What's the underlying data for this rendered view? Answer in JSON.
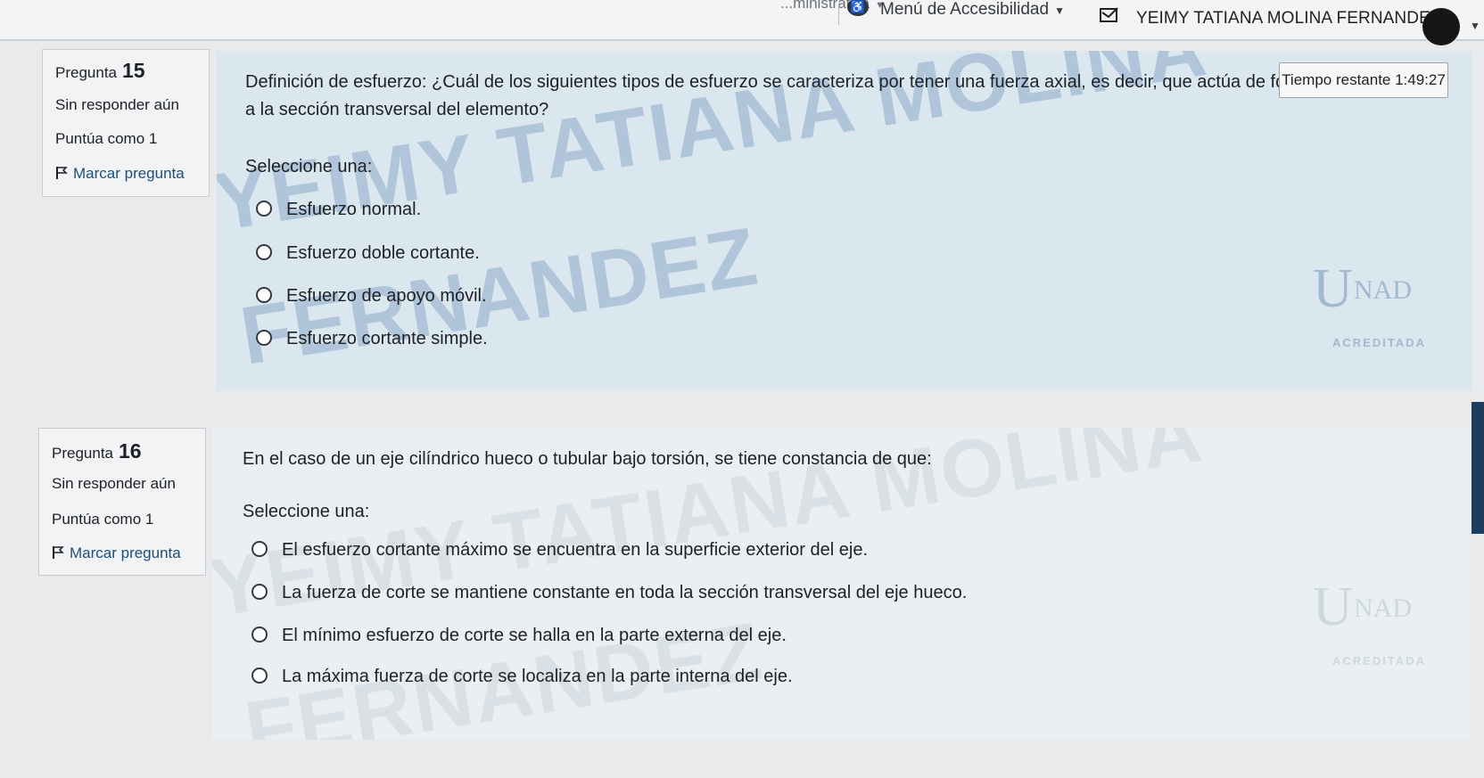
{
  "navbar": {
    "truncated_item": "...ministrativa",
    "accessibility_menu": "Menú de Accesibilidad",
    "user_name": "YEIMY TATIANA MOLINA FERNANDEZ"
  },
  "timer": {
    "label": "Tiempo restante 1:49:27"
  },
  "watermark": {
    "line1": "YEIMY TATIANA MOLINA",
    "line2": "FERNANDEZ"
  },
  "logo": {
    "text_u": "U",
    "text_nad": "NAD",
    "accredited": "ACREDITADA"
  },
  "questions": [
    {
      "label": "Pregunta",
      "number": "15",
      "status": "Sin responder aún",
      "score": "Puntúa como 1",
      "flag": "Marcar pregunta",
      "text": "Definición de esfuerzo: ¿Cuál de los siguientes tipos de esfuerzo se caracteriza por tener una fuerza axial, es decir, que actúa de forma perpendicular a la sección transversal del elemento?",
      "select_label": "Seleccione una:",
      "options": [
        "Esfuerzo normal.",
        "Esfuerzo doble cortante.",
        "Esfuerzo de apoyo móvil.",
        "Esfuerzo cortante simple."
      ]
    },
    {
      "label": "Pregunta",
      "number": "16",
      "status": "Sin responder aún",
      "score": "Puntúa como 1",
      "flag": "Marcar pregunta",
      "text": "En el caso de un eje cilíndrico hueco o tubular bajo torsión, se tiene constancia de que:",
      "select_label": "Seleccione una:",
      "options": [
        "El esfuerzo cortante máximo se encuentra en la superficie exterior del eje.",
        "La fuerza de corte se mantiene constante en toda la sección transversal del eje hueco.",
        "El mínimo esfuerzo de corte se halla en la parte externa del eje.",
        "La máxima fuerza de corte se localiza en la parte interna del eje."
      ]
    }
  ]
}
